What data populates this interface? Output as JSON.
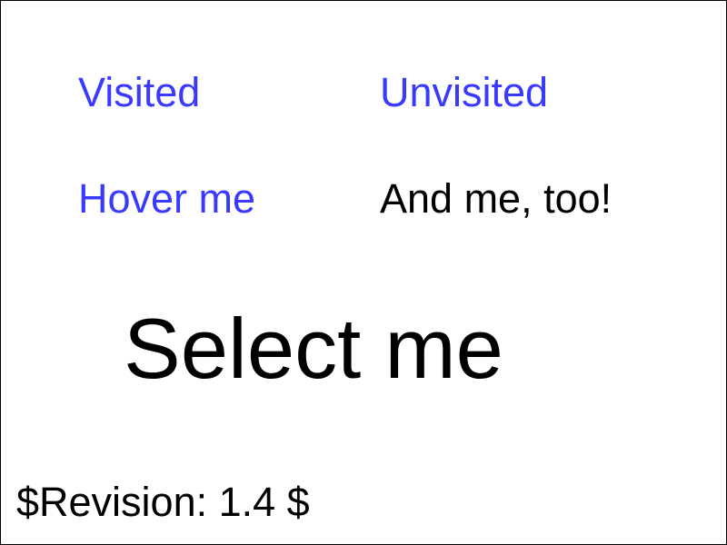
{
  "links": {
    "visited_label": "Visited",
    "unvisited_label": "Unvisited",
    "hover_label": "Hover me"
  },
  "hover_text": "And me, too!",
  "select_text": "Select me",
  "revision": "$Revision: 1.4 $",
  "colors": {
    "link": "#3a3aff",
    "text": "#000000",
    "background": "#ffffff",
    "border": "#000000"
  }
}
